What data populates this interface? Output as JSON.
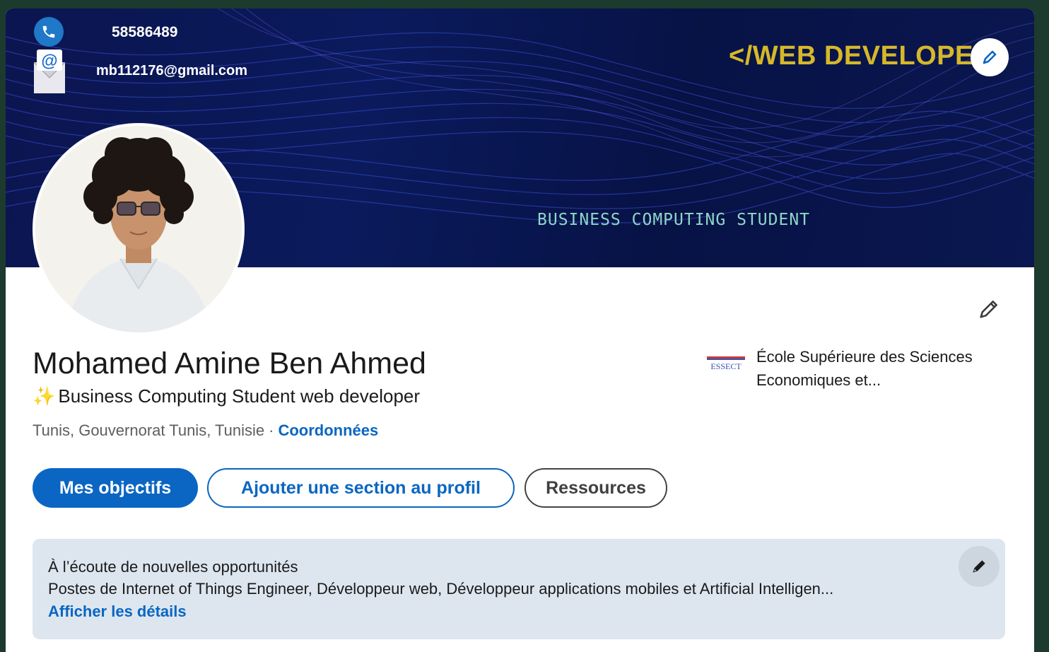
{
  "banner": {
    "phone": "58586489",
    "email": "mb112176@gmail.com",
    "title": "</WEB DEVELOPER>",
    "subtitle": "BUSINESS COMPUTING STUDENT",
    "mail_icon_glyph": "@"
  },
  "profile": {
    "name": "Mohamed Amine Ben Ahmed",
    "headline_emoji": "✨",
    "headline": "Business Computing Student web developer",
    "location": "Tunis, Gouvernorat Tunis, Tunisie",
    "location_separator": "·",
    "contact_link": "Coordonnées",
    "school_logo_text": "ESSECT",
    "school_name": "École Supérieure des Sciences Economiques et..."
  },
  "actions": {
    "primary": "Mes objectifs",
    "add_section": "Ajouter une section au profil",
    "resources": "Ressources"
  },
  "open_to_work": {
    "title": "À l’écoute de nouvelles opportunités",
    "text": "Postes de Internet of Things Engineer, Développeur web, Développeur applications mobiles et Artificial Intelligen...",
    "link": "Afficher les détails"
  },
  "colors": {
    "accent": "#0a66c2",
    "banner_bg": "#0a1750",
    "banner_title": "#d6b829",
    "page_bg": "#1d3a2e"
  }
}
